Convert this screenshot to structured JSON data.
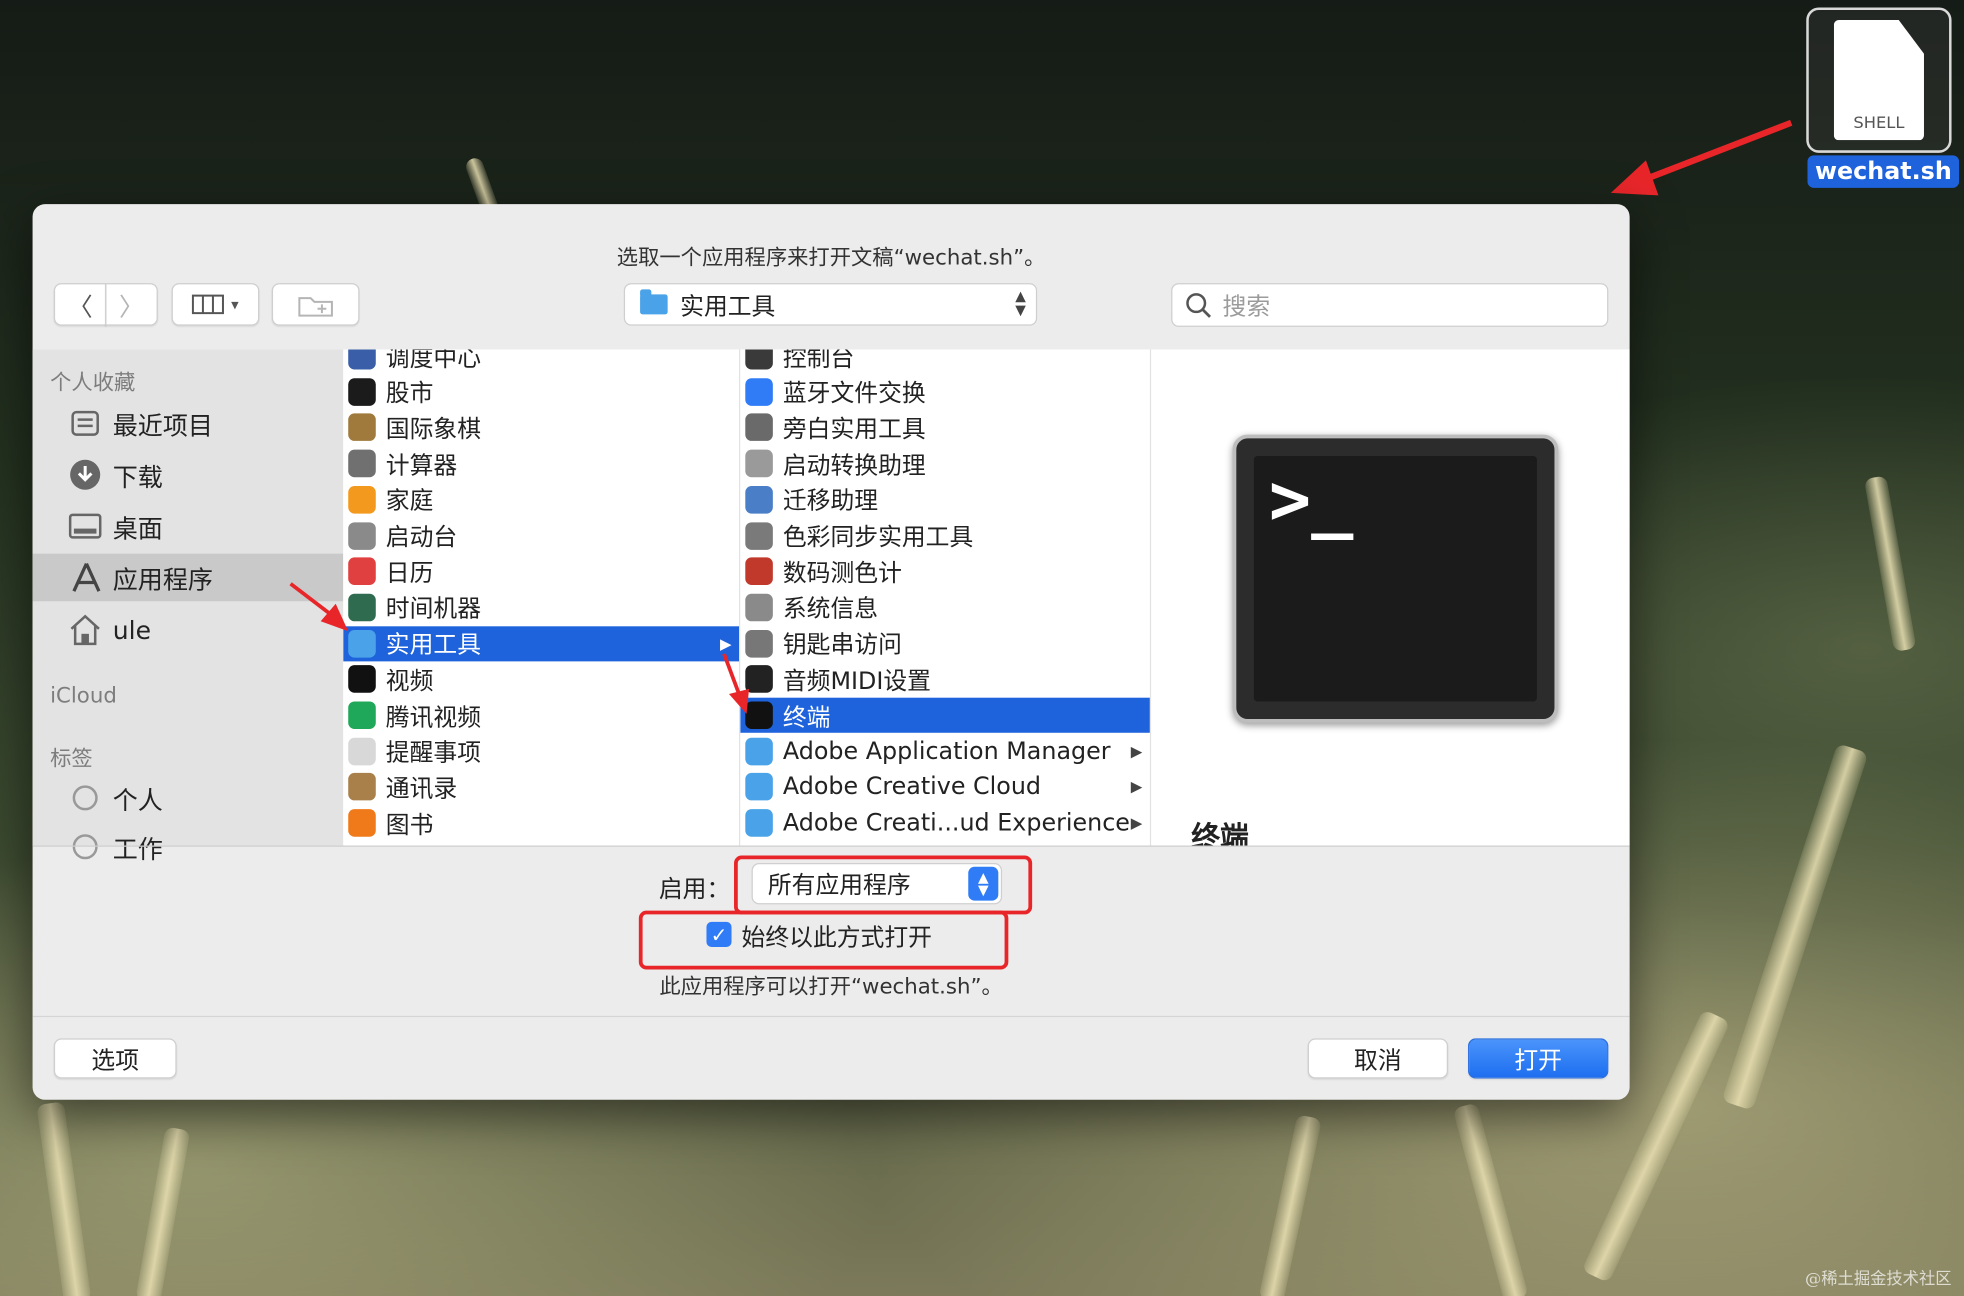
{
  "desktop": {
    "file_icon_label": "SHELL",
    "file_name": "wechat.sh",
    "watermark": "@稀土掘金技术社区"
  },
  "dialog": {
    "title": "选取一个应用程序来打开文稿“wechat.sh”。",
    "path_popup": "实用工具",
    "search_placeholder": "搜索",
    "sidebar": {
      "favorites_header": "个人收藏",
      "items": [
        {
          "label": "最近项目",
          "icon": "recents-icon"
        },
        {
          "label": "下载",
          "icon": "downloads-icon"
        },
        {
          "label": "桌面",
          "icon": "desktop-icon"
        },
        {
          "label": "应用程序",
          "icon": "applications-icon",
          "selected": true
        },
        {
          "label": "ule",
          "icon": "home-icon"
        }
      ],
      "icloud_header": "iCloud",
      "tags_header": "标签",
      "tags": [
        {
          "label": "个人"
        },
        {
          "label": "工作"
        }
      ]
    },
    "column1": [
      {
        "label": "调度中心",
        "icon": "mission-control-icon",
        "color": "#3a5fa8"
      },
      {
        "label": "股市",
        "icon": "stocks-icon",
        "color": "#1b1b1b"
      },
      {
        "label": "国际象棋",
        "icon": "chess-icon",
        "color": "#a07a3c"
      },
      {
        "label": "计算器",
        "icon": "calculator-icon",
        "color": "#707070"
      },
      {
        "label": "家庭",
        "icon": "home-app-icon",
        "color": "#f39a1e"
      },
      {
        "label": "启动台",
        "icon": "launchpad-icon",
        "color": "#8a8a8a"
      },
      {
        "label": "日历",
        "icon": "calendar-icon",
        "color": "#e04040"
      },
      {
        "label": "时间机器",
        "icon": "time-machine-icon",
        "color": "#2f6b4f"
      },
      {
        "label": "实用工具",
        "icon": "utilities-folder-icon",
        "color": "#4aa3e8",
        "selected": true,
        "has_children": true
      },
      {
        "label": "视频",
        "icon": "tv-icon",
        "color": "#111111"
      },
      {
        "label": "腾讯视频",
        "icon": "tencent-video-icon",
        "color": "#1fa85a"
      },
      {
        "label": "提醒事项",
        "icon": "reminders-icon",
        "color": "#d8d8d8"
      },
      {
        "label": "通讯录",
        "icon": "contacts-icon",
        "color": "#a9804a"
      },
      {
        "label": "图书",
        "icon": "books-icon",
        "color": "#f07a1a"
      }
    ],
    "column2": [
      {
        "label": "控制台",
        "icon": "console-icon",
        "color": "#3a3a3a"
      },
      {
        "label": "蓝牙文件交换",
        "icon": "bluetooth-icon",
        "color": "#2f7cf6"
      },
      {
        "label": "旁白实用工具",
        "icon": "voiceover-icon",
        "color": "#6a6a6a"
      },
      {
        "label": "启动转换助理",
        "icon": "bootcamp-icon",
        "color": "#9a9a9a"
      },
      {
        "label": "迁移助理",
        "icon": "migration-icon",
        "color": "#4a7fc8"
      },
      {
        "label": "色彩同步实用工具",
        "icon": "colorsync-icon",
        "color": "#7a7a7a"
      },
      {
        "label": "数码测色计",
        "icon": "digital-color-meter-icon",
        "color": "#c0392b"
      },
      {
        "label": "系统信息",
        "icon": "system-info-icon",
        "color": "#8a8a8a"
      },
      {
        "label": "钥匙串访问",
        "icon": "keychain-icon",
        "color": "#777777"
      },
      {
        "label": "音频MIDI设置",
        "icon": "midi-icon",
        "color": "#222222"
      },
      {
        "label": "终端",
        "icon": "terminal-icon",
        "color": "#111111",
        "selected": true
      },
      {
        "label": "Adobe Application Manager",
        "icon": "folder-icon",
        "color": "#4aa3e8",
        "has_children": true
      },
      {
        "label": "Adobe Creative Cloud",
        "icon": "folder-icon",
        "color": "#4aa3e8",
        "has_children": true
      },
      {
        "label": "Adobe Creati...ud Experience",
        "icon": "folder-icon",
        "color": "#4aa3e8",
        "has_children": true
      }
    ],
    "preview": {
      "icon": "terminal-icon",
      "glyph": ">_",
      "name": "终端"
    },
    "enable_label": "启用：",
    "enable_value": "所有应用程序",
    "always_open_label": "始终以此方式打开",
    "always_open_checked": true,
    "info_text": "此应用程序可以打开“wechat.sh”。",
    "buttons": {
      "options": "选项",
      "cancel": "取消",
      "open": "打开"
    }
  }
}
